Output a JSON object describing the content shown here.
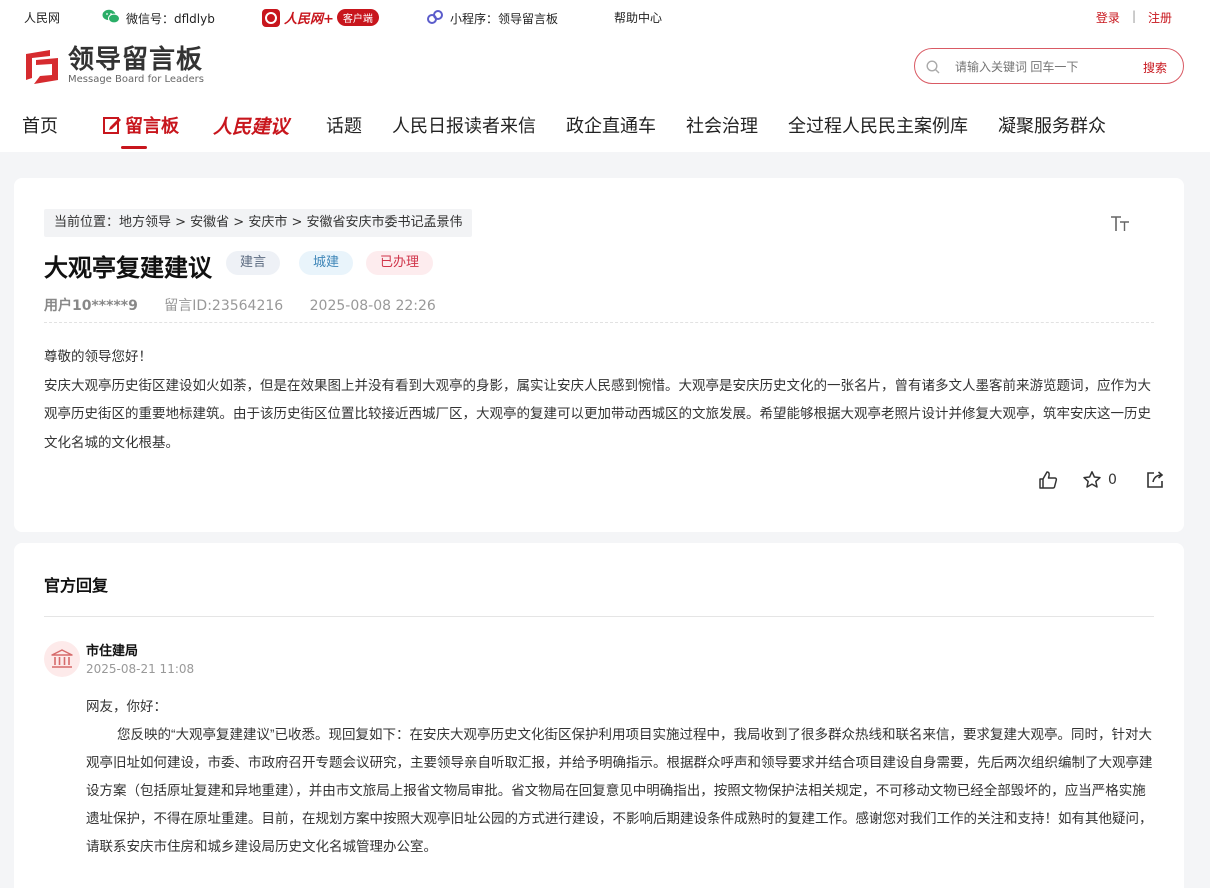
{
  "topbar": {
    "site": "人民网",
    "wechat": "微信号：dfldlyb",
    "app_logo": "人民网+",
    "app_badge": "客户端",
    "mini_program": "小程序：领导留言板",
    "help": "帮助中心",
    "login": "登录",
    "sep": "|",
    "register": "注册"
  },
  "brand": {
    "cn": "领导留言板",
    "en": "Message Board for Leaders"
  },
  "search": {
    "placeholder": "请输入关键词 回车一下",
    "button": "搜索"
  },
  "nav": {
    "home": "首页",
    "board": "留言板",
    "suggest": "人民建议",
    "topics": "话题",
    "letters": "人民日报读者来信",
    "business": "政企直通车",
    "governance": "社会治理",
    "cases": "全过程人民民主案例库",
    "service": "凝聚服务群众"
  },
  "post": {
    "breadcrumb": "当前位置：地方领导 > 安徽省 > 安庆市 > 安徽省安庆市委书记孟景伟",
    "font_toggle": "TT",
    "title": "大观亭复建建议",
    "tags": [
      "建言",
      "城建",
      "已办理"
    ],
    "user": "用户10*****9",
    "msg_id": "留言ID:23564216",
    "time": "2025-08-08 22:26",
    "greeting": "尊敬的领导您好！",
    "body": "安庆大观亭历史街区建设如火如荼，但是在效果图上并没有看到大观亭的身影，属实让安庆人民感到惋惜。大观亭是安庆历史文化的一张名片，曾有诸多文人墨客前来游览题词，应作为大观亭历史街区的重要地标建筑。由于该历史街区位置比较接近西城厂区，大观亭的复建可以更加带动西城区的文旅发展。希望能够根据大观亭老照片设计并修复大观亭，筑牢安庆这一历史文化名城的文化根基。",
    "star_count": "0"
  },
  "official": {
    "heading": "官方回复",
    "department": "市住建局",
    "date": "2025-08-21 11:08",
    "greeting": "网友，你好：",
    "body": "您反映的“大观亭复建建议”已收悉。现回复如下：在安庆大观亭历史文化街区保护利用项目实施过程中，我局收到了很多群众热线和联名来信，要求复建大观亭。同时，针对大观亭旧址如何建设，市委、市政府召开专题会议研究，主要领导亲自听取汇报，并给予明确指示。根据群众呼声和领导要求并结合项目建设自身需要，先后两次组织编制了大观亭建设方案（包括原址复建和异地重建），并由市文旅局上报省文物局审批。省文物局在回复意见中明确指出，按照文物保护法相关规定，不可移动文物已经全部毁坏的，应当严格实施遗址保护，不得在原址重建。目前，在规划方案中按照大观亭旧址公园的方式进行建设，不影响后期建设条件成熟时的复建工作。感谢您对我们工作的关注和支持！如有其他疑问，请联系安庆市住房和城乡建设局历史文化名城管理办公室。"
  },
  "colors": {
    "accent": "#c8161d",
    "page_bg": "#f4f5f7"
  },
  "icons": [
    "wechat-icon",
    "miniprogram-icon",
    "search-icon",
    "like-icon",
    "star-icon",
    "share-icon",
    "government-building-icon"
  ]
}
